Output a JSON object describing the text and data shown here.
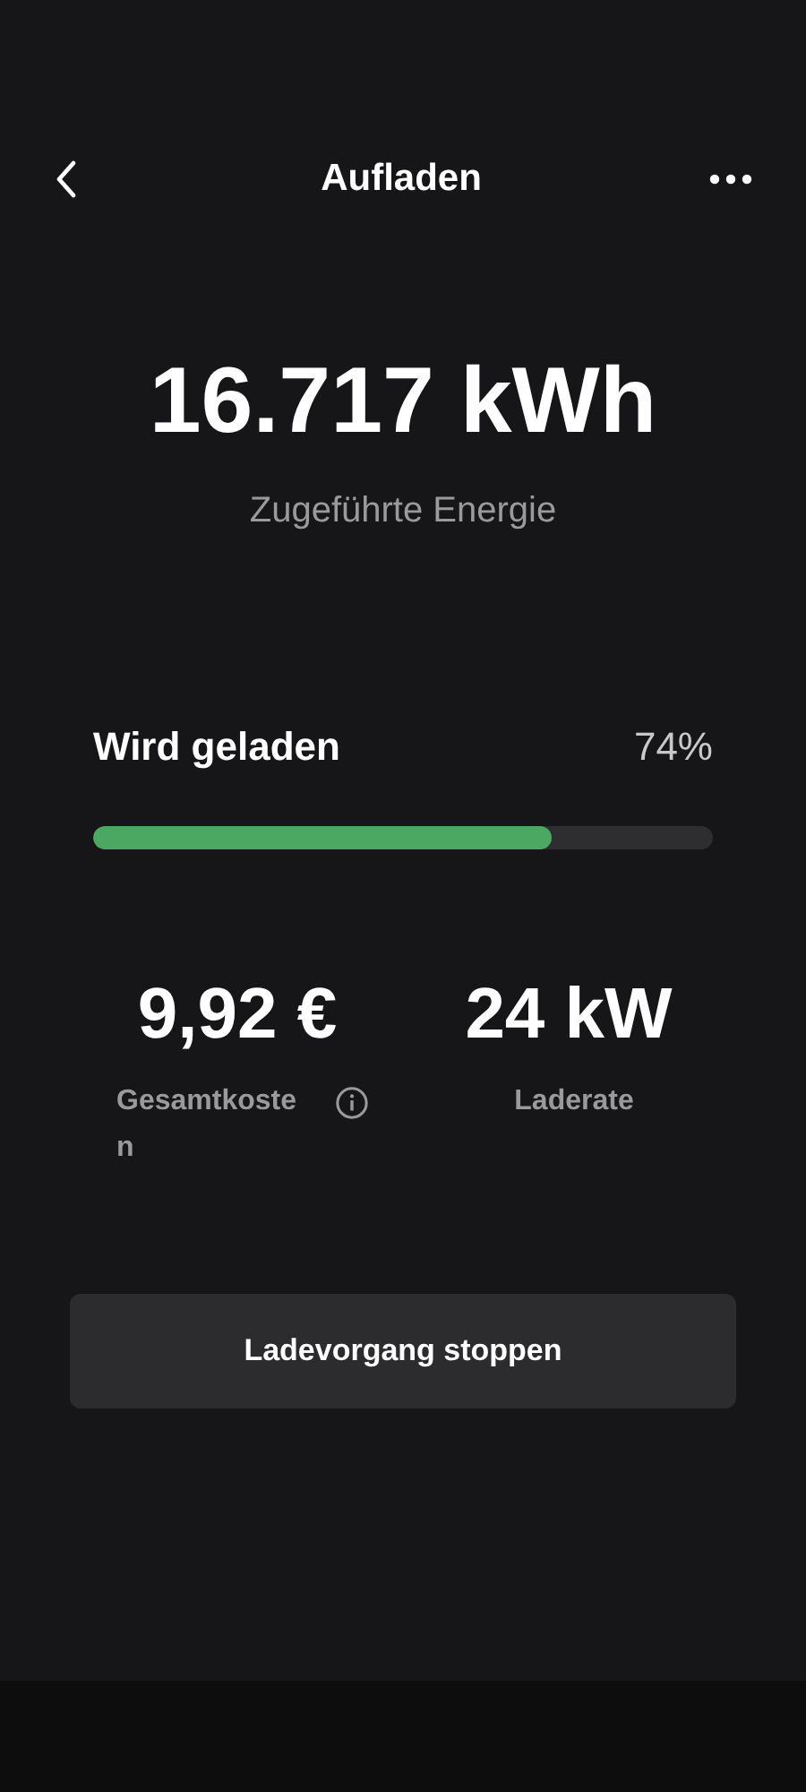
{
  "header": {
    "title": "Aufladen"
  },
  "energy": {
    "value": "16.717 kWh",
    "label": "Zugeführte Energie"
  },
  "charging": {
    "status": "Wird geladen",
    "percent": "74%",
    "level": 0.74
  },
  "stats": [
    {
      "value": "9,92 €",
      "label": "Gesamtkosten",
      "info": true
    },
    {
      "value": "24 kW",
      "label": "Laderate",
      "info": false
    }
  ],
  "button": {
    "label": "Ladevorgang stoppen"
  }
}
